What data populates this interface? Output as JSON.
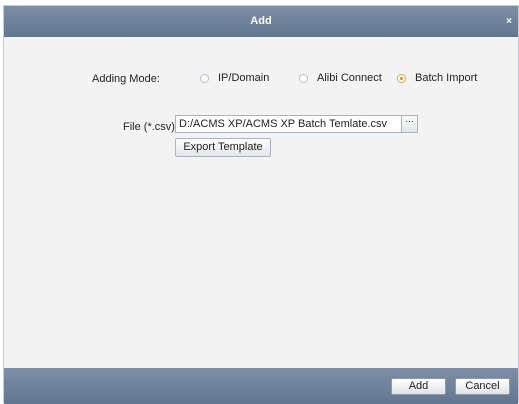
{
  "window": {
    "title": "Add",
    "close_glyph": "×"
  },
  "adding_mode": {
    "label": "Adding Mode:",
    "options": [
      {
        "label": "IP/Domain",
        "checked": false
      },
      {
        "label": "Alibi Connect",
        "checked": false
      },
      {
        "label": "Batch Import",
        "checked": true
      }
    ]
  },
  "file": {
    "label": "File (*.csv):",
    "value": "D:/ACMS XP/ACMS XP Batch Temlate.csv",
    "browse_label": "···"
  },
  "export_template_label": "Export Template",
  "footer": {
    "add_label": "Add",
    "cancel_label": "Cancel"
  },
  "colors": {
    "titlebar": "#6f829b",
    "body_bg": "#f3f3f3",
    "radio_checked": "#e88a12"
  },
  "icons": {
    "close": "close-icon",
    "browse": "browse-icon"
  }
}
